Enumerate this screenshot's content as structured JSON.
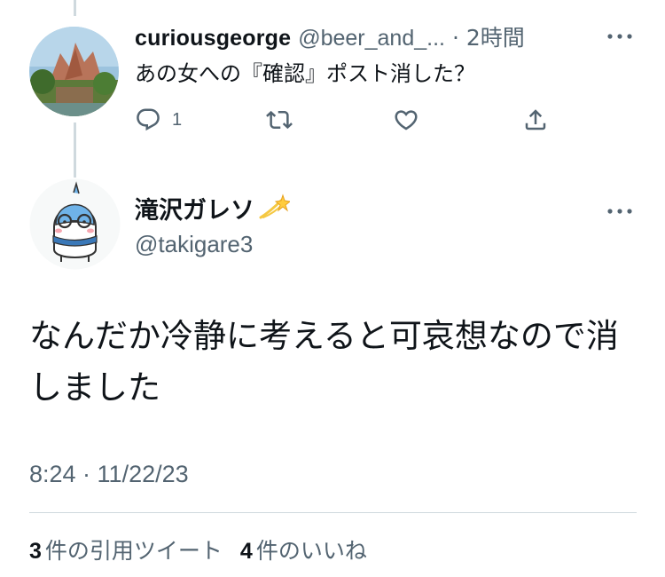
{
  "reply_tweet": {
    "name": "curiousgeorge",
    "handle": "@beer_and_...",
    "separator": "·",
    "time": "2時間",
    "text": "あの女への『確認』ポスト消した？",
    "actions": {
      "reply_count": "1",
      "icons": [
        "reply-icon",
        "retweet-icon",
        "like-icon",
        "share-icon"
      ]
    }
  },
  "main_tweet": {
    "name": "滝沢ガレソ",
    "name_emoji": "dizzy-icon",
    "handle": "@takigare3",
    "text": "なんだか冷静に考えると可哀想なので消しました",
    "timestamp": "8:24 · 11/22/23",
    "stats": [
      {
        "count": "3",
        "label": "件の引用ツイート"
      },
      {
        "count": "4",
        "label": "件のいいね"
      }
    ]
  },
  "colors": {
    "text_primary": "#0f1419",
    "text_secondary": "#536471",
    "divider": "#cfd9de"
  }
}
